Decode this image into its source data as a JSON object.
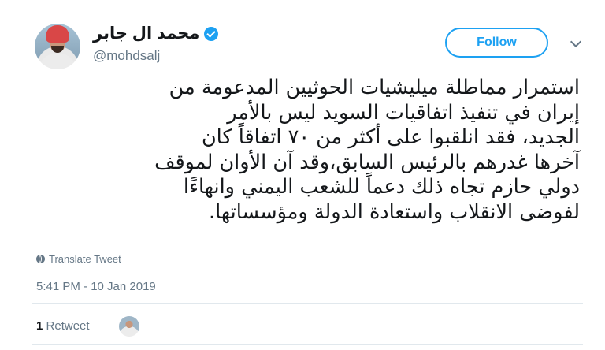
{
  "user": {
    "display_name": "محمد ال جابر",
    "handle": "@mohdsalj"
  },
  "actions": {
    "follow_label": "Follow"
  },
  "tweet": {
    "text": "استمرار مماطلة ميليشيات الحوثيين المدعومة من\nإيران في تنفيذ اتفاقيات السويد  ليس بالأمر\nالجديد، فقد انلقبوا على أكثر من ٧٠ اتفاقاً كان\nآخرها غدرهم بالرئيس السابق،وقد آن الأوان لموقف\nدولي حازم تجاه ذلك دعماً للشعب اليمني وانهاءًا\nلفوضى الانقلاب واستعادة الدولة ومؤسساتها.",
    "translate_label": "Translate Tweet",
    "timestamp": "5:41 PM - 10 Jan 2019"
  },
  "stats": {
    "retweet_count": "1",
    "retweet_label": "Retweet"
  },
  "icons": {
    "verified": "verified-badge-icon",
    "caret": "chevron-down-icon",
    "translate": "globe-icon"
  },
  "colors": {
    "accent": "#1da1f2",
    "muted": "#657786",
    "text": "#14171a"
  }
}
